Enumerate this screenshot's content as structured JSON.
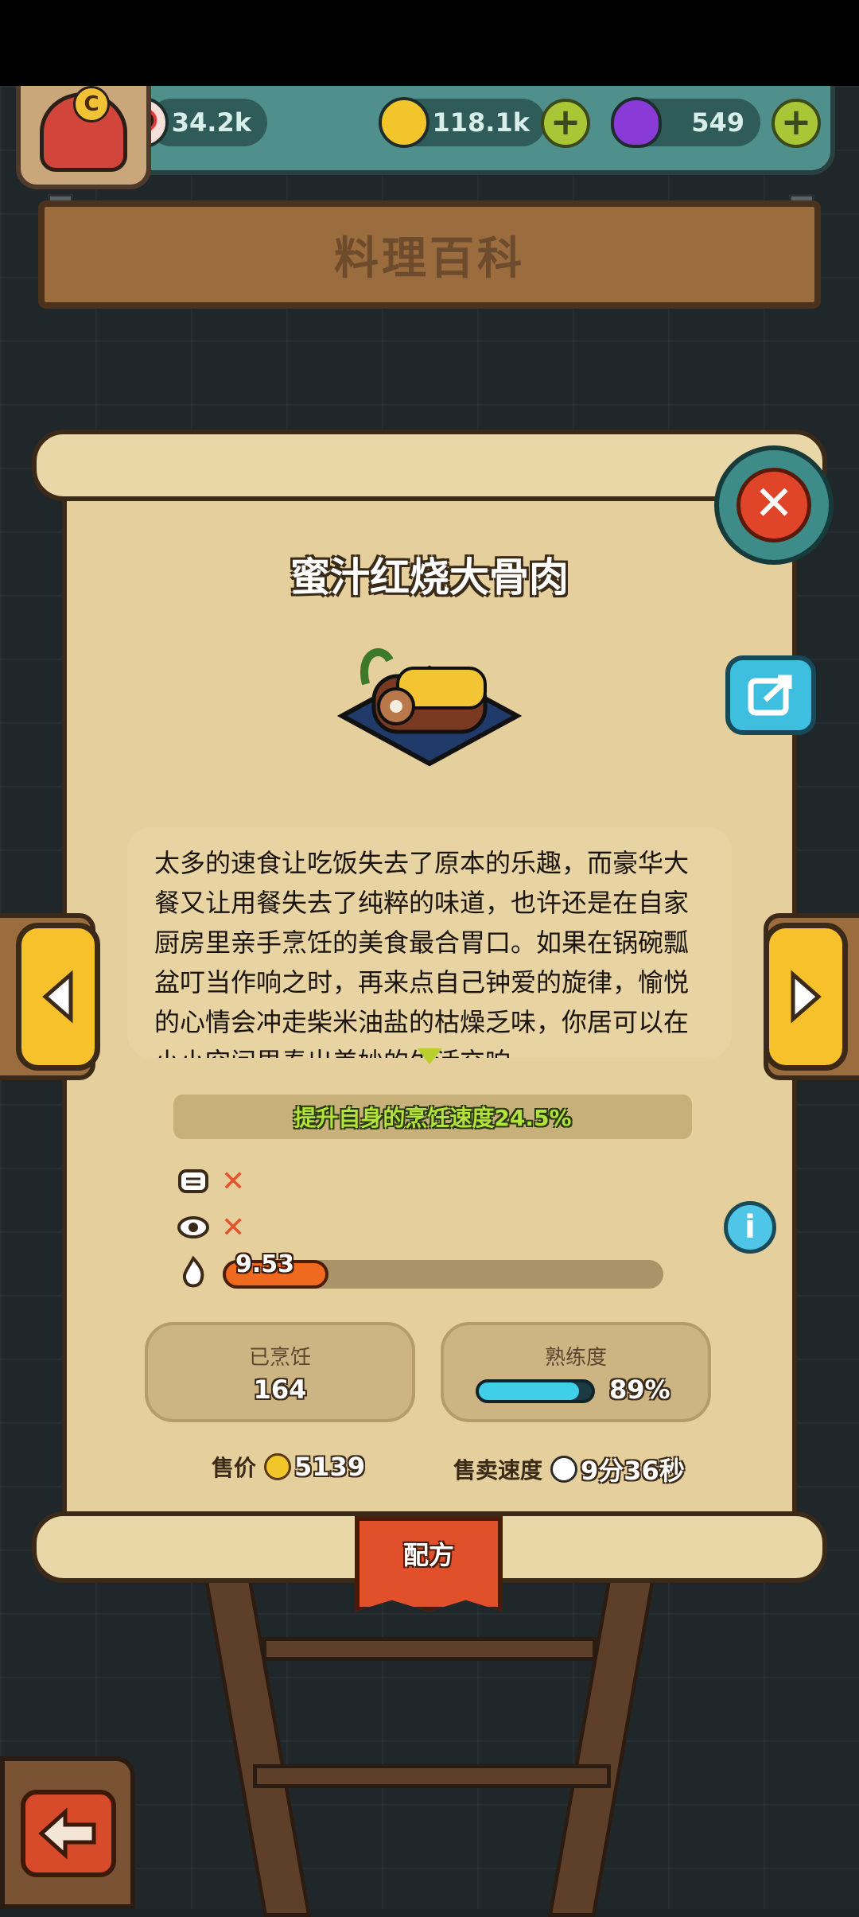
{
  "header": {
    "avatar_rank": "C",
    "resources": [
      {
        "name": "eyeball",
        "value": "34.2k"
      },
      {
        "name": "coin",
        "value": "118.1k"
      },
      {
        "name": "potion",
        "value": "549"
      }
    ],
    "title": "料理百科"
  },
  "dish": {
    "name": "蜜汁红烧大骨肉",
    "description": "太多的速食让吃饭失去了原本的乐趣，而豪华大餐又让用餐失去了纯粹的味道，也许还是在自家厨房里亲手烹饪的美食最合胃口。如果在锅碗瓢盆叮当作响之时，再来点自己钟爱的旋律，愉悦的心情会冲走柴米油盐的枯燥乏味，你居可以在小小空间里奏出美妙的生活交响",
    "effect": "提升自身的烹饪速度24.5%",
    "heat_value": "9.53",
    "heat_fraction": 0.24,
    "cooked_label": "已烹饪",
    "cooked_count": "164",
    "proficiency_label": "熟练度",
    "proficiency_percent": "89%",
    "proficiency_fraction": 0.89,
    "price_label": "售价",
    "price_value": "5139",
    "sell_speed_label": "售卖速度",
    "sell_speed_value": "9分36秒"
  },
  "buttons": {
    "recipe_tab": "配方",
    "close": "close-icon",
    "share": "share-icon",
    "info": "i",
    "prev": "prev-arrow-icon",
    "next": "next-arrow-icon",
    "back": "back-arrow-icon"
  },
  "colors": {
    "scroll": "#e5cf9c",
    "accent_yellow": "#f7c12b",
    "effect_text": "#b3e23a",
    "heat_fill": "#ef6a1f",
    "proficiency_fill": "#3fcfe8",
    "close_red": "#e0452a"
  }
}
